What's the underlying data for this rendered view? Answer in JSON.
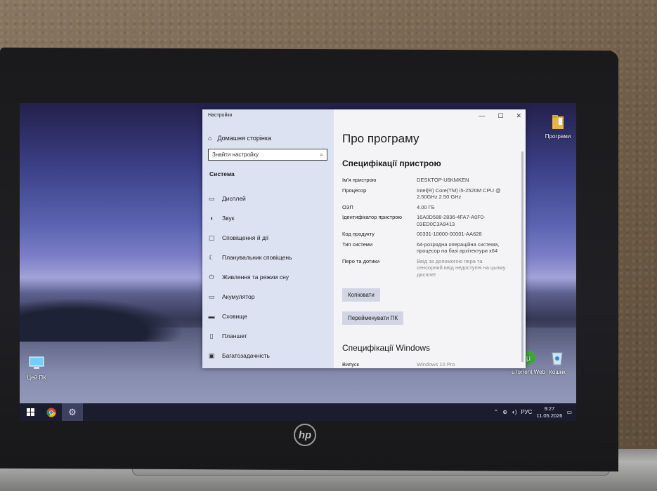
{
  "settings_window": {
    "title": "Настройки",
    "home_label": "Домашня сторінка",
    "search_placeholder": "Знайти настройку",
    "section": "Система",
    "nav_items": [
      {
        "label": "Дисплей",
        "icon": "monitor-icon"
      },
      {
        "label": "Звук",
        "icon": "speaker-icon"
      },
      {
        "label": "Сповіщення й дії",
        "icon": "notification-icon"
      },
      {
        "label": "Планувальник сповіщень",
        "icon": "moon-icon"
      },
      {
        "label": "Живлення та режим сну",
        "icon": "power-icon"
      },
      {
        "label": "Акумулятор",
        "icon": "battery-icon"
      },
      {
        "label": "Сховище",
        "icon": "storage-icon"
      },
      {
        "label": "Планшет",
        "icon": "tablet-icon"
      },
      {
        "label": "Багатозадачність",
        "icon": "multitask-icon"
      }
    ],
    "page_title": "Про програму",
    "device_specs_heading": "Специфікації пристрою",
    "specs": {
      "device_name": {
        "key": "Ім'я пристрою",
        "value": "DESKTOP-U6KMKEN"
      },
      "processor": {
        "key": "Процесор",
        "value": "Intel(R) Core(TM) i5-2520M CPU @ 2.50GHz   2.50 GHz"
      },
      "ram": {
        "key": "ОЗП",
        "value": "4.00 ГБ"
      },
      "device_id": {
        "key": "Ідентифікатор пристрою",
        "value": "16A0D588-2836-4FA7-A0F0-03ED0C3A9413"
      },
      "product_id": {
        "key": "Код продукту",
        "value": "00331-10000-00001-AA628"
      },
      "system_type": {
        "key": "Тип системи",
        "value": "64-розрядна операційна система, процесор на базі архітектури x64"
      },
      "pen_touch": {
        "key": "Перо та дотики",
        "value": "Ввід за допомогою пера та сенсорний ввід недоступні на цьому дисплеї"
      }
    },
    "copy_button": "Копіювати",
    "rename_button": "Перейменувати ПК",
    "windows_specs_heading": "Специфікації Windows",
    "edition": {
      "key": "Випуск",
      "value": "Windows 10 Pro"
    }
  },
  "desktop_icons": {
    "programs": "Програми",
    "this_pc": "Цей ПК",
    "utorrent": "uTorrent Web",
    "recycle_bin": "Кошик"
  },
  "taskbar": {
    "language": "РУС",
    "time": "9:27",
    "date": "11.05.2026"
  },
  "laptop": {
    "brand": "hp"
  }
}
